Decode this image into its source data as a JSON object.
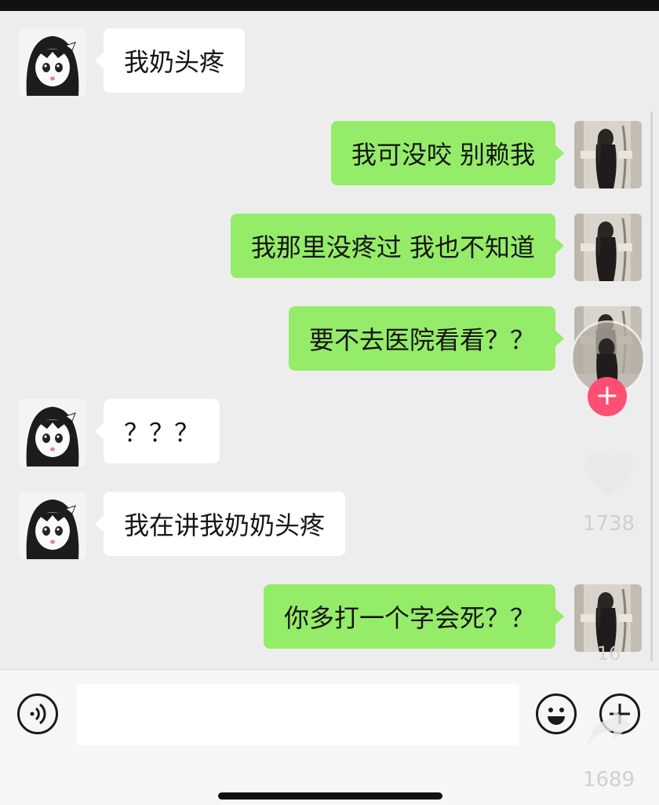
{
  "messages": [
    {
      "side": "in",
      "text": "我奶头疼"
    },
    {
      "side": "out",
      "text": "我可没咬 别赖我"
    },
    {
      "side": "out",
      "text": "我那里没疼过 我也不知道"
    },
    {
      "side": "out",
      "text": "要不去医院看看？？"
    },
    {
      "side": "in",
      "text": "？？？"
    },
    {
      "side": "in",
      "text": "我在讲我奶奶头疼"
    },
    {
      "side": "out",
      "text": "你多打一个字会死？？"
    }
  ],
  "overlay": {
    "like_count": "1738",
    "comment_count": "16",
    "share_count": "1689",
    "plus_badge": "+",
    "accent_color": "#fe4f73"
  },
  "input_bar": {
    "placeholder": "",
    "icons": [
      "voice-icon",
      "emoji-icon",
      "plus-icon"
    ]
  },
  "colors": {
    "outgoing_bubble": "#95ec69",
    "incoming_bubble": "#ffffff",
    "background": "#ededed"
  }
}
